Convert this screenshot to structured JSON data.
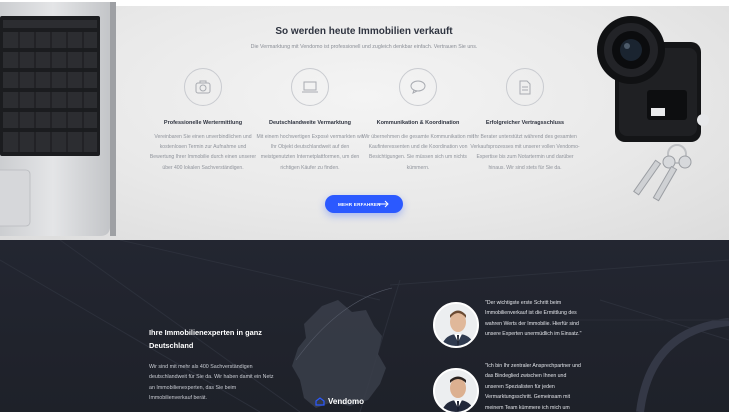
{
  "top": {
    "headline": "So werden heute Immobilien verkauft",
    "intro": "Die Vermarktung mit Vendomo ist professionell und zugleich denkbar einfach. Vertrauen Sie uns.",
    "features": [
      {
        "icon": "camera-icon",
        "title": "Professionelle Wertermittlung",
        "text": "Vereinbaren Sie einen unverbindlichen und kostenlosen Termin zur Aufnahme und Bewertung Ihrer Immobilie durch einen unserer über 400 lokalen Sachverständigen."
      },
      {
        "icon": "laptop-icon",
        "title": "Deutschlandweite Vermarktung",
        "text": "Mit einem hochwertigen Exposé vermarkten wir Ihr Objekt deutschlandweit auf den meistgenutzten Internetplattformen, um den richtigen Käufer zu finden."
      },
      {
        "icon": "chat-bubble-icon",
        "title": "Kommunikation & Koordination",
        "text": "Wir übernehmen die gesamte Kommunikation mit Kaufinteressenten und die Koordination von Besichtigungen. Sie müssen sich um nichts kümmern."
      },
      {
        "icon": "document-icon",
        "title": "Erfolgreicher Vertragsschluss",
        "text": "Ihr Berater unterstützt während des gesamten Verkaufsprozesses mit unserer vollen Vendomo-Expertise bis zum Notartermin und darüber hinaus. Wir sind stets für Sie da."
      }
    ],
    "cta_label": "MEHR ERFAHREN",
    "accent": "#2b59ff"
  },
  "bottom": {
    "title": "Ihre Immobilienexperten in ganz Deutschland",
    "text": "Wir sind mit mehr als 400 Sachverständigen deutschlandweit für Sie da. Wir haben damit ein Netz an Immobilienexperten, das Sie beim Immobilienverkauf berät.",
    "brand": "Vendomo",
    "quotes": [
      "\"Der wichtigste erste Schritt beim Immobilienverkauf ist die Ermittlung des wahren Werts der Immobilie. Hierfür sind unsere Experten unermüdlich im Einsatz.\"",
      "\"Ich bin Ihr zentraler Ansprechpartner und das Bindeglied zwischen Ihnen und unseren Spezialisten für jeden Vermarktungsschritt. Gemeinsam mit meinem Team kümmere ich mich um"
    ]
  }
}
